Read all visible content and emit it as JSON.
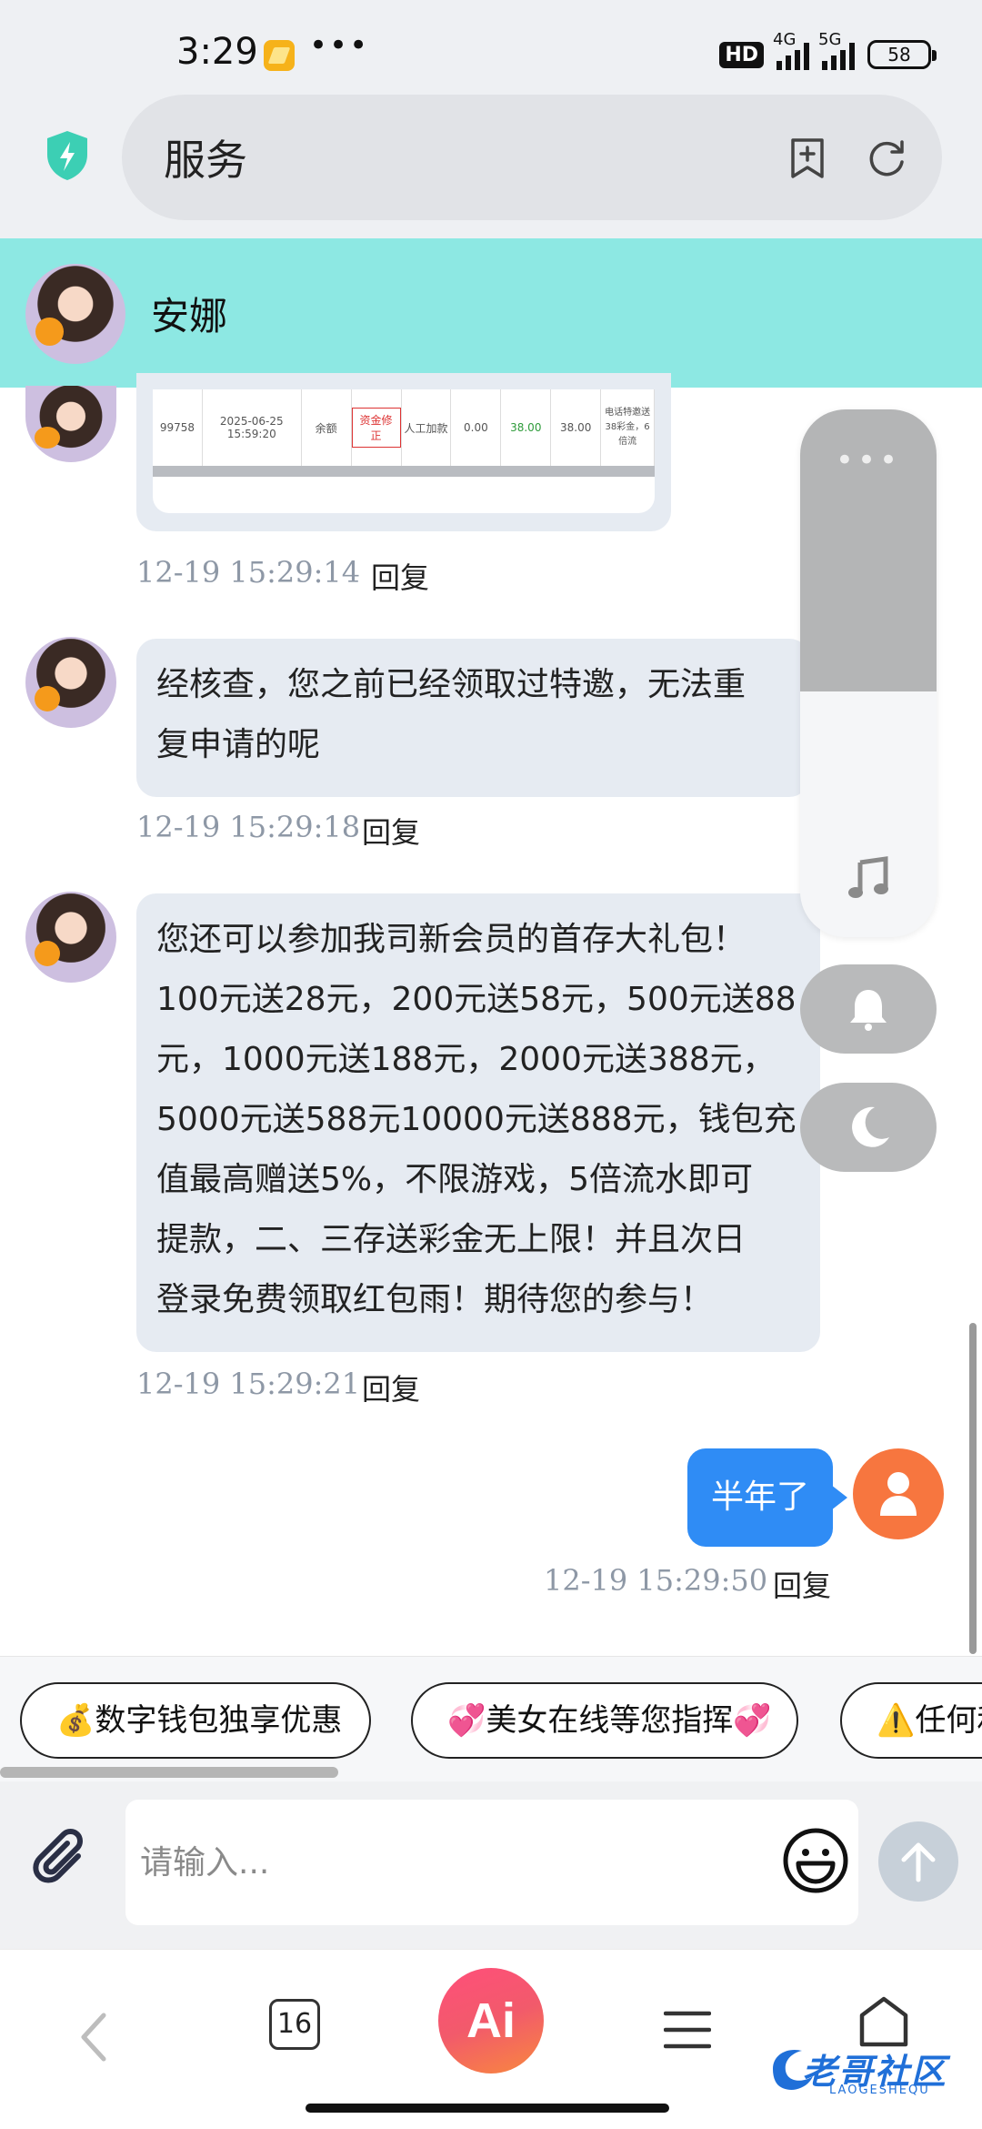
{
  "status_bar": {
    "time": "3:29",
    "hd_badge": "HD",
    "network_4g": "4G",
    "network_5g": "5G",
    "battery": "58"
  },
  "browser": {
    "url_text": "服务"
  },
  "chat": {
    "agent_name": "安娜",
    "reply_label": "回复",
    "image_message": {
      "columns": [
        "99758",
        "2025-06-25 15:59:20",
        "余额",
        "资金修正",
        "人工加款",
        "0.00",
        "38.00",
        "38.00",
        "电话特邀送38彩金，6倍流"
      ],
      "time": "12-19 15:29:14"
    },
    "messages": [
      {
        "lines": [
          "经核查，您之前已经领取过特邀，无法重",
          "复申请的呢"
        ],
        "time": "12-19 15:29:18"
      },
      {
        "lines": [
          "您还可以参加我司新会员的首存大礼包！",
          "100元送28元，200元送58元，500元送88",
          "元，1000元送188元，2000元送388元，",
          "5000元送588元10000元送888元，钱包充",
          "值最高赠送5%，不限游戏，5倍流水即可",
          "提款，二、三存送彩金无上限！并且次日",
          "登录免费领取红包雨！期待您的参与！"
        ],
        "time": "12-19 15:29:21"
      }
    ],
    "outgoing": {
      "text": "半年了",
      "time": "12-19 15:29:50"
    }
  },
  "float_panel": {
    "dots": "•••"
  },
  "quick_replies": [
    "💰数字钱包独享优惠",
    "💞美女在线等您指挥💞",
    "⚠️任何和"
  ],
  "input": {
    "placeholder": "请输入..."
  },
  "bottom_nav": {
    "tab_count": "16",
    "ai_label": "Ai"
  },
  "watermark": {
    "title": "老哥社区",
    "subtitle": "LAOGESHEQU"
  },
  "colors": {
    "header_bg": "#8de8e3",
    "bubble_in": "#e6ebf2",
    "bubble_out": "#2f8cf5",
    "user_avatar": "#f7763f"
  }
}
